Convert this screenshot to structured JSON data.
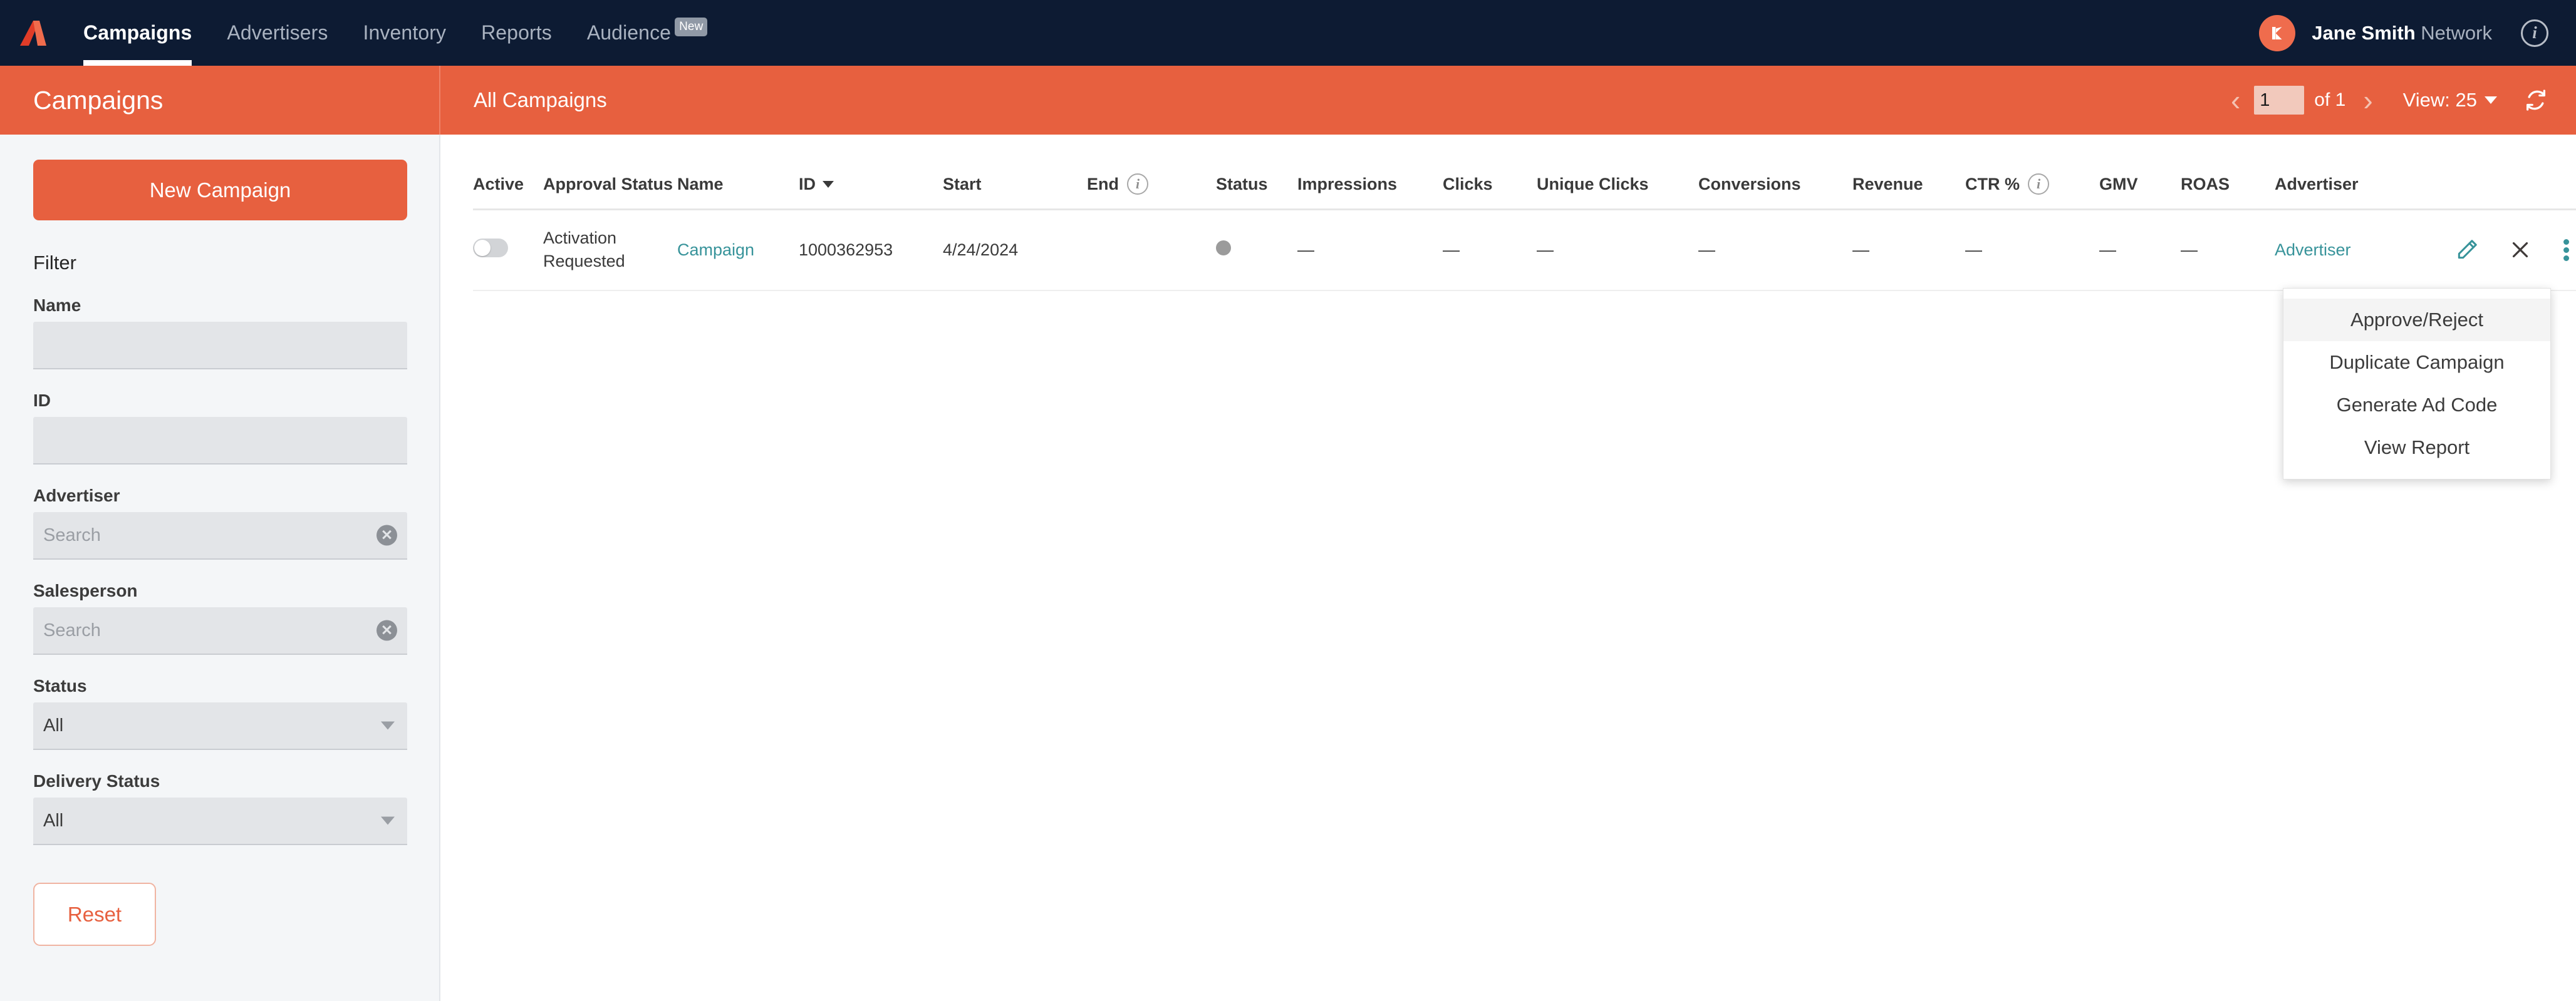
{
  "topnav": {
    "logo_name": "kevel-logo",
    "items": [
      {
        "label": "Campaigns",
        "active": true,
        "badge": null
      },
      {
        "label": "Advertisers",
        "active": false,
        "badge": null
      },
      {
        "label": "Inventory",
        "active": false,
        "badge": null
      },
      {
        "label": "Reports",
        "active": false,
        "badge": null
      },
      {
        "label": "Audience",
        "active": false,
        "badge": "New"
      }
    ],
    "avatar_initial": "K",
    "user_name": "Jane Smith",
    "user_scope": "Network",
    "info_icon": "i"
  },
  "subbar": {
    "title": "Campaigns",
    "section": "All Campaigns",
    "prev_arrow": "‹",
    "next_arrow": "›",
    "page_value": "1",
    "page_of": "of 1",
    "view_label": "View: 25",
    "refresh_icon": "refresh-icon"
  },
  "sidebar": {
    "new_campaign_label": "New Campaign",
    "filter_heading": "Filter",
    "fields": [
      {
        "label": "Name",
        "type": "text",
        "value": "",
        "placeholder": ""
      },
      {
        "label": "ID",
        "type": "text",
        "value": "",
        "placeholder": ""
      },
      {
        "label": "Advertiser",
        "type": "search",
        "value": "",
        "placeholder": "Search",
        "clear": "✕"
      },
      {
        "label": "Salesperson",
        "type": "search",
        "value": "",
        "placeholder": "Search",
        "clear": "✕"
      },
      {
        "label": "Status",
        "type": "select",
        "value": "All"
      },
      {
        "label": "Delivery Status",
        "type": "select",
        "value": "All"
      }
    ],
    "reset_label": "Reset"
  },
  "table": {
    "columns": [
      {
        "key": "active",
        "label": "Active",
        "sort": false,
        "info": false
      },
      {
        "key": "approval",
        "label": "Approval Status",
        "sort": false,
        "info": false
      },
      {
        "key": "name",
        "label": "Name",
        "sort": false,
        "info": false
      },
      {
        "key": "id",
        "label": "ID",
        "sort": true,
        "info": false
      },
      {
        "key": "start",
        "label": "Start",
        "sort": false,
        "info": false
      },
      {
        "key": "end",
        "label": "End",
        "sort": false,
        "info": true
      },
      {
        "key": "status",
        "label": "Status",
        "sort": false,
        "info": false
      },
      {
        "key": "impressions",
        "label": "Impressions",
        "sort": false,
        "info": false
      },
      {
        "key": "clicks",
        "label": "Clicks",
        "sort": false,
        "info": false
      },
      {
        "key": "unique_clicks",
        "label": "Unique Clicks",
        "sort": false,
        "info": false
      },
      {
        "key": "conversions",
        "label": "Conversions",
        "sort": false,
        "info": false
      },
      {
        "key": "revenue",
        "label": "Revenue",
        "sort": false,
        "info": false
      },
      {
        "key": "ctr",
        "label": "CTR %",
        "sort": false,
        "info": true
      },
      {
        "key": "gmv",
        "label": "GMV",
        "sort": false,
        "info": false
      },
      {
        "key": "roas",
        "label": "ROAS",
        "sort": false,
        "info": false
      },
      {
        "key": "advertiser",
        "label": "Advertiser",
        "sort": false,
        "info": false
      },
      {
        "key": "actions",
        "label": "",
        "sort": false,
        "info": false
      }
    ],
    "rows": [
      {
        "active": false,
        "approval": "Activation Requested",
        "name": "Campaign",
        "id": "1000362953",
        "start": "4/24/2024",
        "end": "",
        "status_dot": true,
        "impressions": "—",
        "clicks": "—",
        "unique_clicks": "—",
        "conversions": "—",
        "revenue": "—",
        "ctr": "—",
        "gmv": "—",
        "roas": "—",
        "advertiser": "Advertiser"
      }
    ]
  },
  "row_menu": {
    "items": [
      {
        "label": "Approve/Reject",
        "hovered": true
      },
      {
        "label": "Duplicate Campaign",
        "hovered": false
      },
      {
        "label": "Generate Ad Code",
        "hovered": false
      },
      {
        "label": "View Report",
        "hovered": false
      }
    ]
  },
  "colors": {
    "brand_orange": "#e7603f",
    "navy": "#0d1b33",
    "teal_link": "#37939a",
    "sidebar_bg": "#f4f6f8"
  }
}
